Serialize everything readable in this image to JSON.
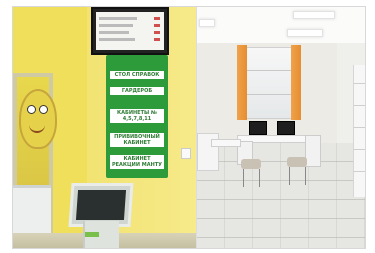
{
  "scene": {
    "left_photo": {
      "sign": {
        "items": [
          "СТОЛ СПРАВОК",
          "ГАРДЕРОБ",
          "КАБИНЕТЫ № 4,5,7,8,11",
          "ПРИВИВОЧНЫЙ КАБИНЕТ",
          "КАБИНЕТ РЕАКЦИИ МАНТУ"
        ],
        "color": "#2e9b3a"
      },
      "wall_color": "#f0df5a"
    },
    "right_photo": {
      "curtain_color": "#e58e30",
      "wall_color": "#ecebe6"
    }
  }
}
